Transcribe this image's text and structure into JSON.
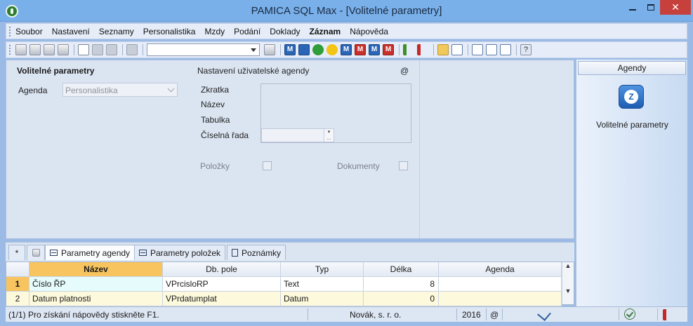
{
  "window": {
    "title": "PAMICA SQL Max - [Volitelné parametry]",
    "close": "✕"
  },
  "menu": {
    "items": [
      {
        "label": "Soubor",
        "bold": false
      },
      {
        "label": "Nastavení",
        "bold": false
      },
      {
        "label": "Seznamy",
        "bold": false
      },
      {
        "label": "Personalistika",
        "bold": false
      },
      {
        "label": "Mzdy",
        "bold": false
      },
      {
        "label": "Podání",
        "bold": false
      },
      {
        "label": "Doklady",
        "bold": false
      },
      {
        "label": "Záznam",
        "bold": true
      },
      {
        "label": "Nápověda",
        "bold": false
      }
    ]
  },
  "toolbar": {
    "m_label": "M",
    "help_label": "?"
  },
  "form": {
    "title": "Volitelné parametry",
    "agenda_label": "Agenda",
    "agenda_value": "Personalistika",
    "user_agenda_title": "Nastavení uživatelské agendy",
    "at_symbol": "@",
    "zkratka_label": "Zkratka",
    "nazev_label": "Název",
    "tabulka_label": "Tabulka",
    "ciselna_rada_label": "Číselná řada",
    "polozky_label": "Položky",
    "dokumenty_label": "Dokumenty"
  },
  "side": {
    "header": "Agendy",
    "item_label": "Volitelné parametry"
  },
  "tabs": {
    "star": "*",
    "items": [
      {
        "label": "Parametry agendy",
        "active": true
      },
      {
        "label": "Parametry položek",
        "active": false
      },
      {
        "label": "Poznámky",
        "active": false
      }
    ]
  },
  "grid": {
    "columns": [
      "Název",
      "Db. pole",
      "Typ",
      "Délka",
      "Agenda"
    ],
    "rows": [
      {
        "num": "1",
        "nazev": "Číslo ŘP",
        "db_pole": "VPrcisloRP",
        "typ": "Text",
        "delka": "8",
        "agenda": ""
      },
      {
        "num": "2",
        "nazev": "Datum platnosti",
        "db_pole": "VPrdatumplat",
        "typ": "Datum",
        "delka": "0",
        "agenda": ""
      }
    ]
  },
  "status": {
    "help_text": "(1/1) Pro získání nápovědy stiskněte F1.",
    "company": "Novák, s. r. o.",
    "year": "2016",
    "at_symbol": "@"
  }
}
